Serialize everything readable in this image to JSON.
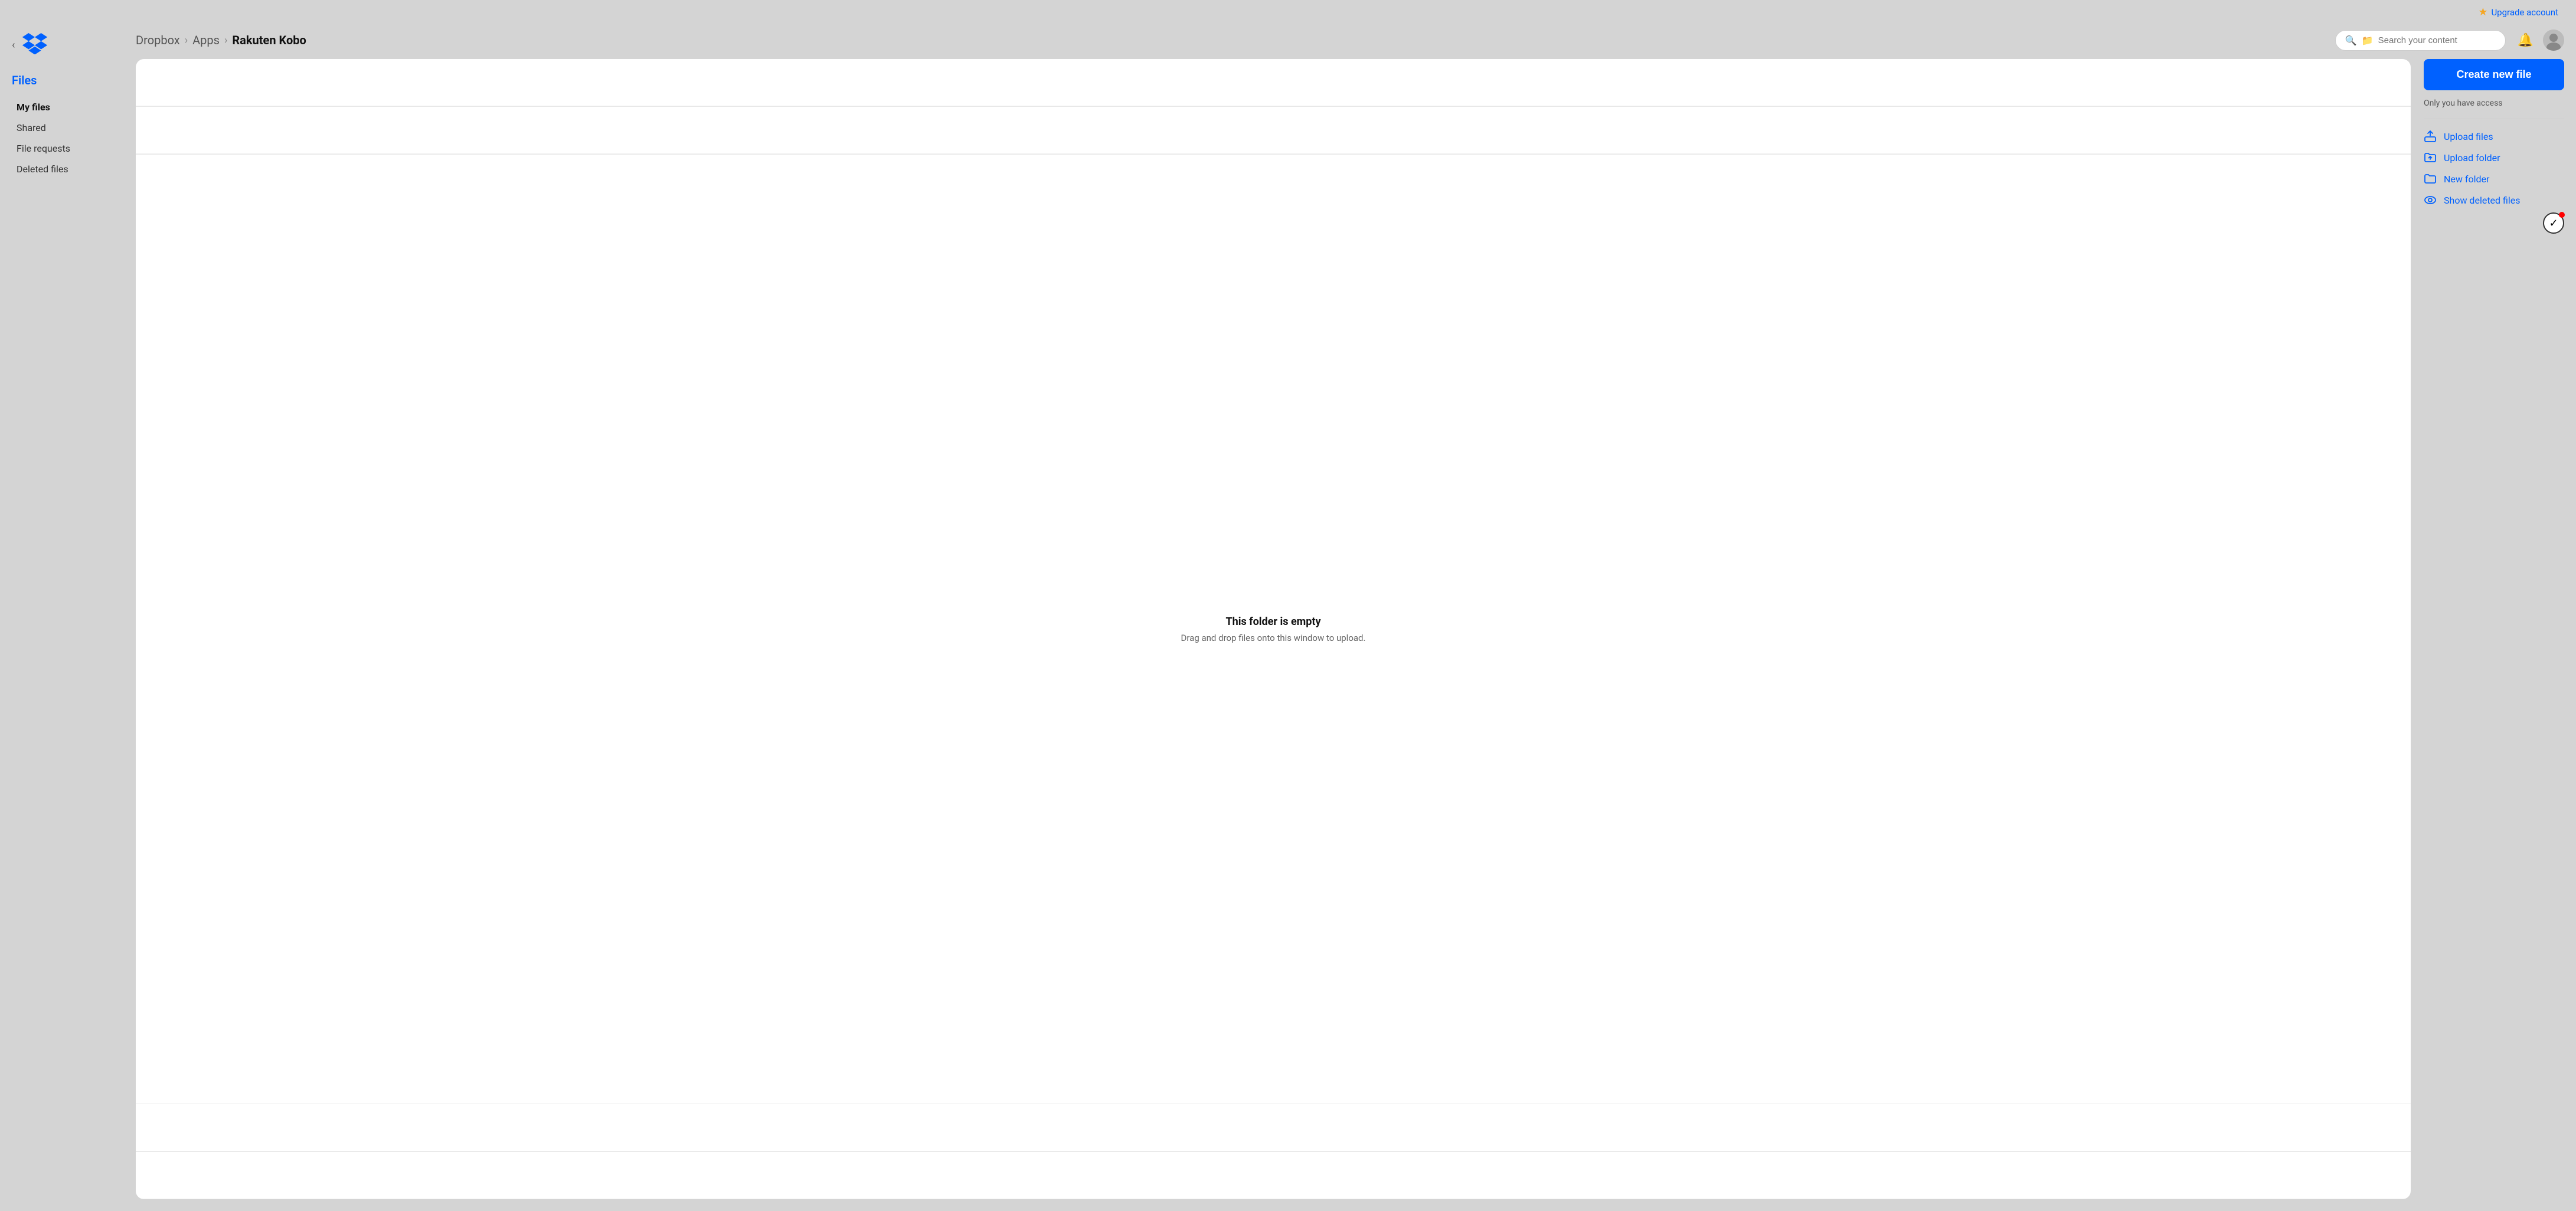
{
  "topbar": {
    "upgrade_label": "Upgrade account"
  },
  "sidebar": {
    "section_title": "Files",
    "nav_items": [
      {
        "id": "my-files",
        "label": "My files",
        "active": true
      },
      {
        "id": "shared",
        "label": "Shared",
        "active": false
      },
      {
        "id": "file-requests",
        "label": "File requests",
        "active": false
      },
      {
        "id": "deleted-files",
        "label": "Deleted files",
        "active": false
      }
    ]
  },
  "breadcrumb": {
    "parts": [
      {
        "label": "Dropbox",
        "current": false
      },
      {
        "label": "Apps",
        "current": false
      },
      {
        "label": "Rakuten Kobo",
        "current": true
      }
    ],
    "separator": "›"
  },
  "search": {
    "placeholder": "Search your content"
  },
  "folder": {
    "empty_title": "This folder is empty",
    "empty_subtitle": "Drag and drop files onto this window to upload."
  },
  "right_panel": {
    "create_button_label": "Create new file",
    "access_label": "Only you have access",
    "actions": [
      {
        "id": "upload-files",
        "label": "Upload files",
        "icon": "upload-file-icon"
      },
      {
        "id": "upload-folder",
        "label": "Upload folder",
        "icon": "upload-folder-icon"
      },
      {
        "id": "new-folder",
        "label": "New folder",
        "icon": "new-folder-icon"
      },
      {
        "id": "show-deleted",
        "label": "Show deleted files",
        "icon": "show-deleted-icon"
      }
    ]
  },
  "colors": {
    "accent": "#0061ff",
    "star": "#f5a623"
  }
}
